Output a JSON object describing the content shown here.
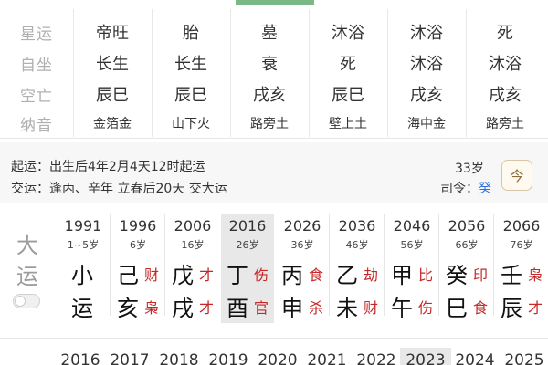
{
  "pillars_table": {
    "rows": [
      {
        "label": "星运",
        "cells": [
          "帝旺",
          "胎",
          "墓",
          "沐浴",
          "沐浴",
          "死"
        ]
      },
      {
        "label": "自坐",
        "cells": [
          "长生",
          "长生",
          "衰",
          "死",
          "沐浴",
          "沐浴"
        ]
      },
      {
        "label": "空亡",
        "cells": [
          "辰巳",
          "辰巳",
          "戌亥",
          "辰巳",
          "戌亥",
          "戌亥"
        ]
      },
      {
        "label": "纳音",
        "cells": [
          "金箔金",
          "山下火",
          "路旁土",
          "壁上土",
          "海中金",
          "路旁土"
        ]
      }
    ]
  },
  "info": {
    "qiyun": "起运：出生后4年2月4天12时起运",
    "jiaoyun": "交运：逢丙、辛年 立春后20天 交大运",
    "age": "33岁",
    "siling_label": "司令：",
    "siling_value": "癸",
    "calendar_icon_text": "今",
    "siling_color": "#2f6fde"
  },
  "dayun": {
    "title_top": "大",
    "title_bottom": "运",
    "columns": [
      {
        "year": "1991",
        "age": "1~5岁",
        "gan": "小",
        "gan_god": "",
        "zhi": "运",
        "zhi_god": ""
      },
      {
        "year": "1996",
        "age": "6岁",
        "gan": "己",
        "gan_god": "财",
        "zhi": "亥",
        "zhi_god": "枭"
      },
      {
        "year": "2006",
        "age": "16岁",
        "gan": "戊",
        "gan_god": "才",
        "zhi": "戌",
        "zhi_god": "才"
      },
      {
        "year": "2016",
        "age": "26岁",
        "gan": "丁",
        "gan_god": "伤",
        "zhi": "酉",
        "zhi_god": "官"
      },
      {
        "year": "2026",
        "age": "36岁",
        "gan": "丙",
        "gan_god": "食",
        "zhi": "申",
        "zhi_god": "杀"
      },
      {
        "year": "2036",
        "age": "46岁",
        "gan": "乙",
        "gan_god": "劫",
        "zhi": "未",
        "zhi_god": "财"
      },
      {
        "year": "2046",
        "age": "56岁",
        "gan": "甲",
        "gan_god": "比",
        "zhi": "午",
        "zhi_god": "伤"
      },
      {
        "year": "2056",
        "age": "66岁",
        "gan": "癸",
        "gan_god": "印",
        "zhi": "巳",
        "zhi_god": "食"
      },
      {
        "year": "2066",
        "age": "76岁",
        "gan": "壬",
        "gan_god": "枭",
        "zhi": "辰",
        "zhi_god": "才"
      }
    ],
    "active_year": "2016",
    "god_color": "#c62828"
  },
  "liunian": {
    "years": [
      "2016",
      "2017",
      "2018",
      "2019",
      "2020",
      "2021",
      "2022",
      "2023",
      "2024",
      "2025"
    ],
    "active_year": "2023"
  }
}
